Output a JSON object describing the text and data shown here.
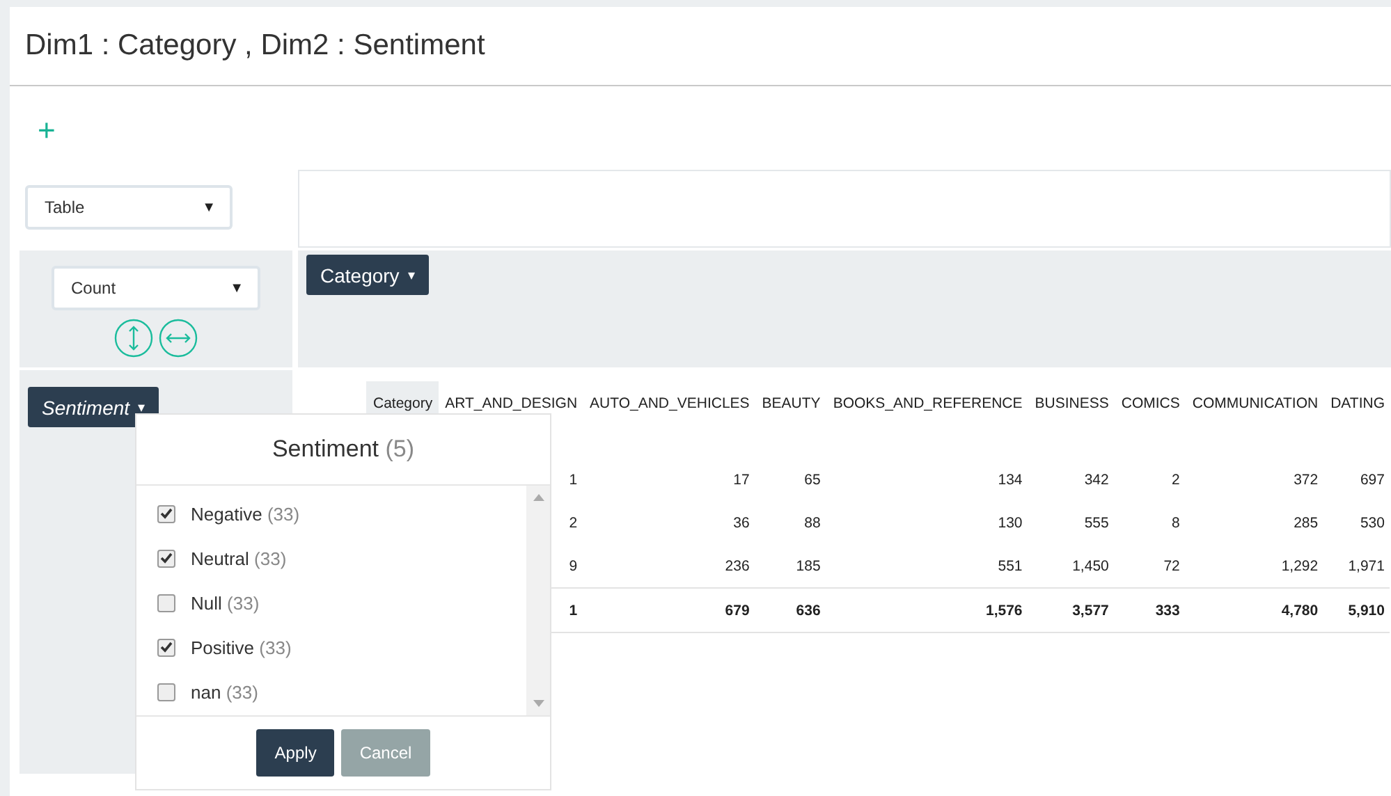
{
  "header": {
    "title": "Dim1 : Category , Dim2 : Sentiment"
  },
  "add_button": "+",
  "renderer_select": {
    "value": "Table",
    "arrow": "▼"
  },
  "aggregator_select": {
    "value": "Count",
    "arrow": "▼"
  },
  "column_field": {
    "label": "Category",
    "caret": "▾"
  },
  "row_field": {
    "label": "Sentiment",
    "caret": "▾"
  },
  "table": {
    "row_header": "Category",
    "columns": [
      "ART_AND_DESIGN",
      "AUTO_AND_VEHICLES",
      "BEAUTY",
      "BOOKS_AND_REFERENCE",
      "BUSINESS",
      "COMICS",
      "COMMUNICATION",
      "DATING"
    ],
    "rows": [
      {
        "kind": "data",
        "cells": [
          "1",
          "17",
          "65",
          "134",
          "342",
          "2",
          "372",
          "697"
        ]
      },
      {
        "kind": "data",
        "cells": [
          "2",
          "36",
          "88",
          "130",
          "555",
          "8",
          "285",
          "530"
        ]
      },
      {
        "kind": "data",
        "cells": [
          "9",
          "236",
          "185",
          "551",
          "1,450",
          "72",
          "1,292",
          "1,971"
        ]
      },
      {
        "kind": "total",
        "cells": [
          "1",
          "679",
          "636",
          "1,576",
          "3,577",
          "333",
          "4,780",
          "5,910"
        ]
      }
    ]
  },
  "filter_popup": {
    "title": "Sentiment",
    "count": "(5)",
    "items": [
      {
        "label": "Negative",
        "count": "(33)",
        "checked": true
      },
      {
        "label": "Neutral",
        "count": "(33)",
        "checked": true
      },
      {
        "label": "Null",
        "count": "(33)",
        "checked": false
      },
      {
        "label": "Positive",
        "count": "(33)",
        "checked": true
      },
      {
        "label": "nan",
        "count": "(33)",
        "checked": false
      }
    ],
    "buttons": [
      {
        "label": "Apply",
        "kind": "primary"
      },
      {
        "label": "Cancel",
        "kind": "secondary"
      }
    ]
  }
}
